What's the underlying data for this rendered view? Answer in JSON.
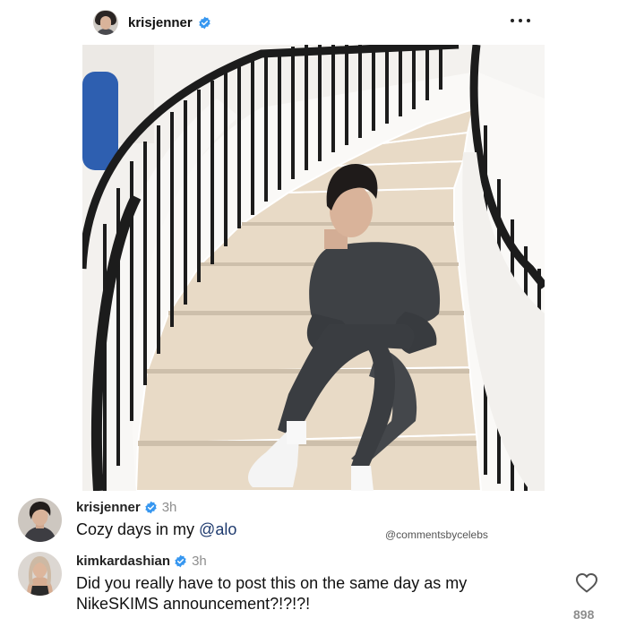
{
  "post": {
    "username": "krisjenner",
    "icons": {
      "verified": "verified-badge-icon",
      "more": "more-options-icon",
      "like": "heart-outline-icon"
    },
    "image": {
      "alt_icon": "photo-woman-sitting-on-spiral-staircase",
      "colors": {
        "sweatsuit": "#3e4145",
        "stairs": "#e8dac6",
        "railing": "#1c1c1c",
        "wall": "#f3f1ee"
      }
    }
  },
  "colors": {
    "verified": "#3797f0",
    "mention": "#1e3a6e",
    "meta": "#8e8e8e"
  },
  "comments": [
    {
      "username": "krisjenner",
      "time": "3h",
      "text_before": "Cozy days in my ",
      "mention": "@alo",
      "text_after": ""
    },
    {
      "username": "kimkardashian",
      "time": "3h",
      "line1": "Did you really have to post this on the same day as my",
      "line2": "NikeSKIMS announcement?!?!?!",
      "likes": "898"
    }
  ],
  "watermark": "@commentsbycelebs"
}
